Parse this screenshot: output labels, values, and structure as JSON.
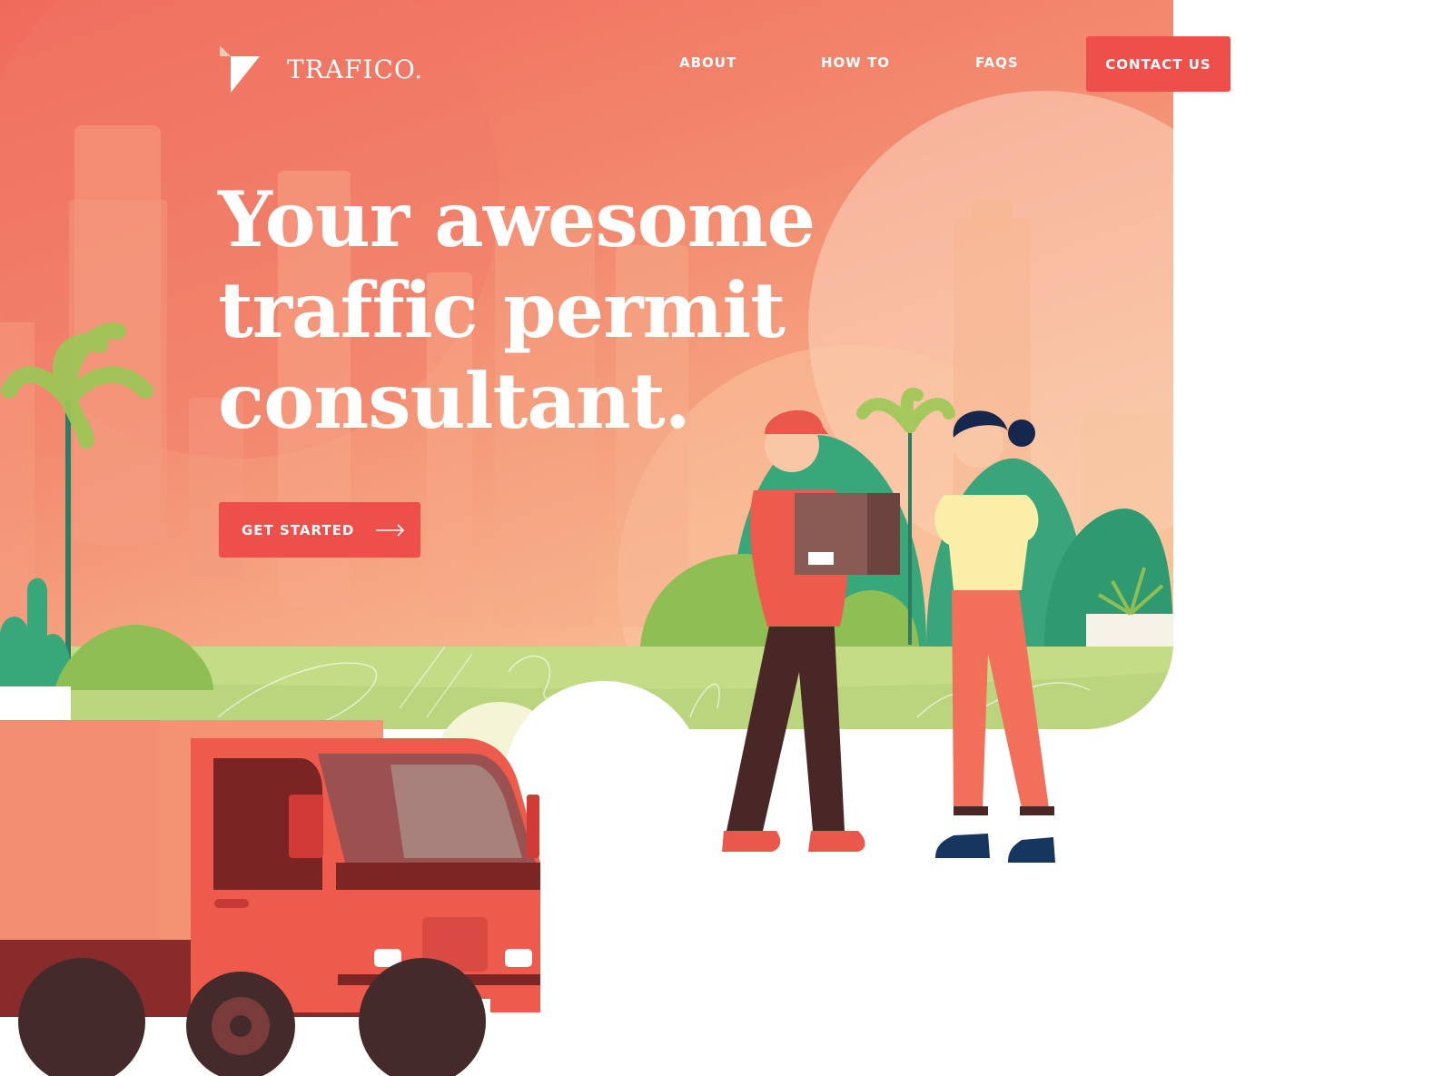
{
  "brand": {
    "name": "TRAFICO.",
    "logo_icon": "triangle-logo-icon"
  },
  "nav": {
    "items": [
      {
        "label": "ABOUT"
      },
      {
        "label": "HOW TO"
      },
      {
        "label": "FAQS"
      }
    ],
    "contact_label": "CONTACT US"
  },
  "hero": {
    "headline_lines": [
      "Your awesome",
      "traffic permit",
      "consultant."
    ],
    "cta_label": "GET STARTED",
    "cta_icon": "arrow-right-icon"
  },
  "colors": {
    "accent": "#ee4f4a",
    "hero_top": "#f06a5c",
    "hero_bottom": "#f9d3a6",
    "grass": "#c5dc86",
    "foliage": "#38a77a",
    "truck": "#ee5a4b"
  }
}
